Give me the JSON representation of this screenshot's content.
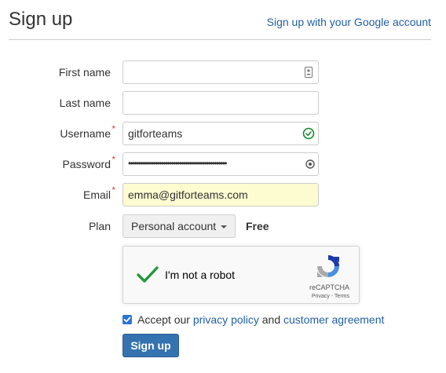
{
  "header": {
    "title": "Sign up",
    "google_link": "Sign up with your Google account"
  },
  "form": {
    "first_name": {
      "label": "First name",
      "value": ""
    },
    "last_name": {
      "label": "Last name",
      "value": ""
    },
    "username": {
      "label": "Username",
      "required_mark": "*",
      "value": "gitforteams"
    },
    "password": {
      "label": "Password",
      "required_mark": "*",
      "masked": "••••••••••••••••••••••••••••••••••••••••••••••••"
    },
    "email": {
      "label": "Email",
      "required_mark": "*",
      "value": "emma@gitforteams.com"
    },
    "plan": {
      "label": "Plan",
      "selected": "Personal account",
      "price": "Free"
    }
  },
  "captcha": {
    "text": "I'm not a robot",
    "brand": "reCAPTCHA",
    "links": "Privacy - Terms",
    "checked": true
  },
  "agreement": {
    "prefix": "Accept our",
    "privacy_link": "privacy policy",
    "and": "and",
    "customer_link": "customer agreement",
    "checked": true
  },
  "submit_label": "Sign up",
  "colors": {
    "link": "#2160a5",
    "primary_button": "#3572b0",
    "required": "#d04437",
    "valid": "#14892c",
    "autofill": "#fdfbd0"
  },
  "icons": {
    "contact_card": "contact-card-icon",
    "valid": "check-circle-icon",
    "password_reveal": "password-reveal-icon",
    "captcha_check": "check-icon",
    "captcha_logo": "recaptcha-logo-icon",
    "checkbox": "checkbox-checked-icon"
  }
}
